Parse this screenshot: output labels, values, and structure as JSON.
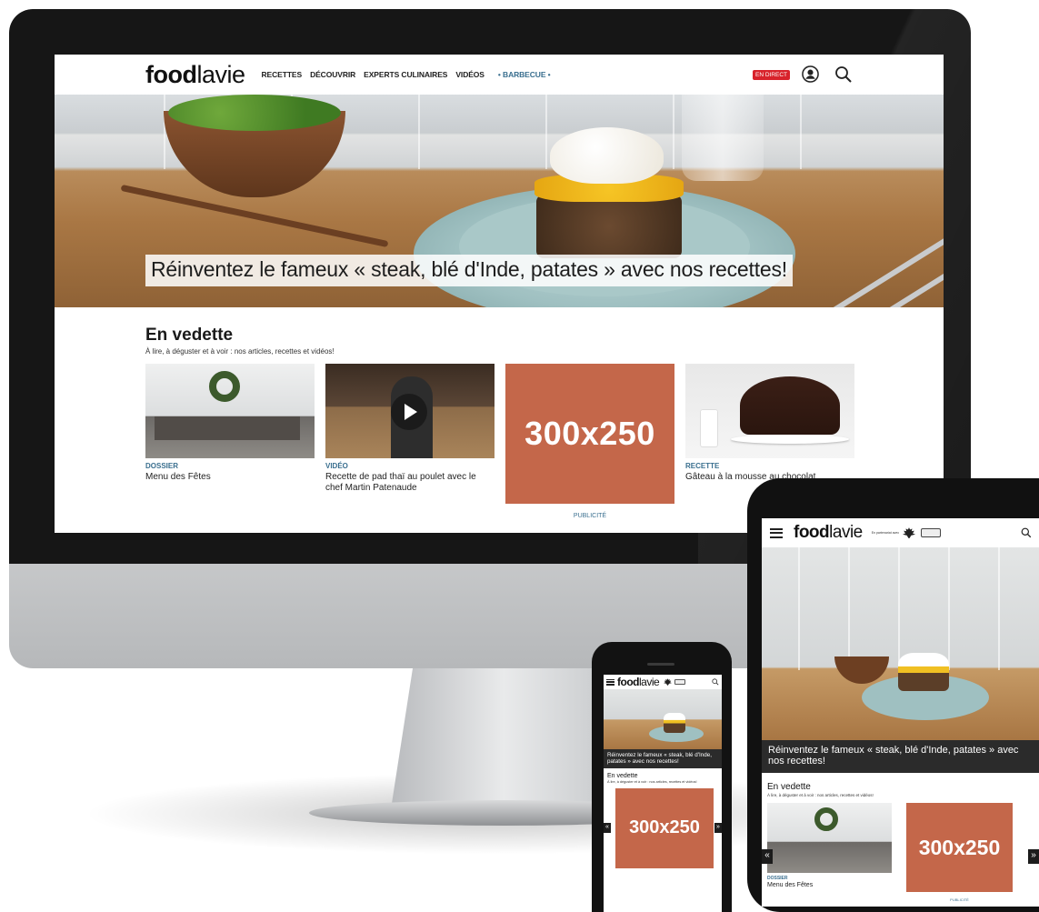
{
  "desktop": {
    "logo": {
      "bold": "food",
      "light": "lavie"
    },
    "nav": [
      "RECETTES",
      "DÉCOUVRIR",
      "EXPERTS CULINAIRES",
      "VIDÉOS",
      "• BARBECUE •"
    ],
    "live_badge": "EN DIRECT",
    "icons": [
      "user-icon",
      "search-icon"
    ],
    "hero_caption": "Réinventez le fameux « steak, blé d'Inde, patates » avec nos recettes!",
    "featured": {
      "title": "En vedette",
      "subtitle": "À lire, à déguster et à voir : nos articles, recettes et vidéos!",
      "cards": [
        {
          "category": "DOSSIER",
          "title": "Menu des Fêtes"
        },
        {
          "category": "VIDÉO",
          "title": "Recette de pad thaï au poulet avec le chef Martin Patenaude"
        },
        {
          "category": "RECETTE",
          "title": "Gâteau à la mousse au chocolat"
        }
      ],
      "ad": {
        "label": "300x250",
        "caption": "PUBLICITÉ"
      }
    }
  },
  "tablet": {
    "logo": {
      "bold": "food",
      "light": "lavie"
    },
    "partner_text": "En partenariat avec",
    "hero_caption": "Réinventez le fameux « steak, blé d'Inde, patates » avec nos recettes!",
    "featured": {
      "title": "En vedette",
      "subtitle": "À lire, à déguster et à voir : nos articles, recettes et vidéos!",
      "card": {
        "category": "DOSSIER",
        "title": "Menu des Fêtes"
      },
      "ad": {
        "label": "300x250",
        "caption": "PUBLICITÉ"
      }
    },
    "arrows": {
      "prev": "«",
      "next": "»"
    }
  },
  "phone": {
    "logo": {
      "bold": "food",
      "light": "lavie"
    },
    "hero_caption": "Réinventez le fameux « steak, blé d'Inde, patates » avec nos recettes!",
    "featured": {
      "title": "En vedette",
      "subtitle": "À lire, à déguster et à voir : nos articles, recettes et vidéos!",
      "ad": {
        "label": "300x250"
      }
    },
    "arrows": {
      "prev": "«",
      "next": "»"
    }
  },
  "colors": {
    "accent_blue": "#3a6f8f",
    "ad_orange": "#c4674a",
    "live_red": "#d8222b"
  }
}
